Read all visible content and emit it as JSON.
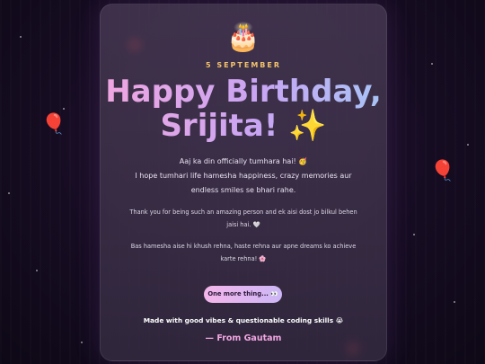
{
  "card": {
    "cake_icon": "🎂",
    "date": "5 SEPTEMBER",
    "title_line1": "Happy Birthday,",
    "title_line2": "Srijita!",
    "title_sparkle": "✨",
    "message_line1": "Aaj ka din officially tumhara hai! 🥳",
    "message_line2": "I hope tumhari life hamesha happiness, crazy memories aur",
    "message_line3": "endless smiles se bhari rahe.",
    "thanks_line1": "Thank you for being such an amazing person and ek aisi dost jo bilkul behen",
    "thanks_line2": "jaisi hai. 🤍",
    "wish_line1": "Bas hamesha aise hi khush rehna, haste rehna aur apne dreams ko achieve",
    "wish_line2": "karte rehna! 🌸",
    "button_label": "One more thing... 👀",
    "made_with": "Made with good vibes & questionable coding skills 😭",
    "from": "— From Gautam"
  },
  "decor": {
    "balloon_icon": "🎈",
    "glow_color": "#ff3b3b",
    "accent_gold": "#f2c36b",
    "accent_pink": "#f0a6e0"
  }
}
